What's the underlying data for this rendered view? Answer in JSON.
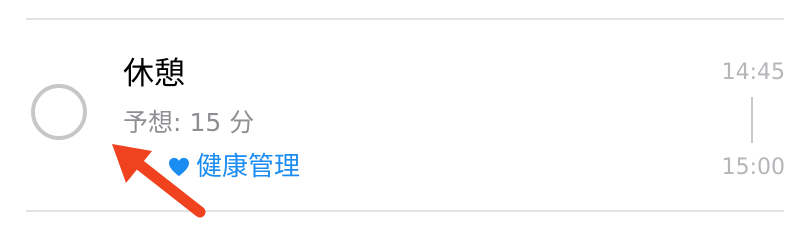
{
  "task": {
    "title": "休憩",
    "estimate_label": "予想:",
    "estimate_value": "15 分",
    "category_icon": "heart-icon",
    "category_label": "健康管理",
    "start_time": "14:45",
    "end_time": "15:00"
  },
  "colors": {
    "accent": "#1a8cf2",
    "annotation_arrow": "#f0421e",
    "secondary_text": "#8e8e93",
    "time_text": "#b5b5ba",
    "circle_border": "#c7c7c7"
  }
}
